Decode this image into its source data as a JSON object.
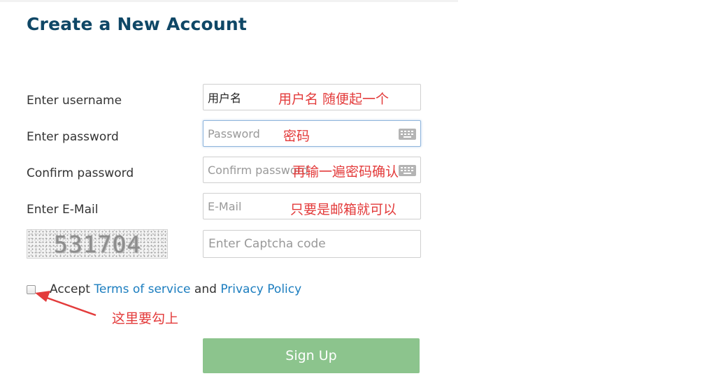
{
  "title": "Create a New Account",
  "labels": {
    "username": "Enter username",
    "password": "Enter password",
    "confirm": "Confirm password",
    "email": "Enter E-Mail"
  },
  "fields": {
    "username_value": "用户名",
    "password_placeholder": "Password",
    "confirm_placeholder": "Confirm password",
    "email_placeholder": "E-Mail",
    "captcha_placeholder": "Enter Captcha code"
  },
  "captcha_text": "531704",
  "annotations": {
    "username": "用户名  随便起一个",
    "password": "密码",
    "confirm": "再输一遍密码确认",
    "email": "只要是邮箱就可以",
    "checkbox": "这里要勾上"
  },
  "terms": {
    "accept": "Accept",
    "terms_link": "Terms of service",
    "and": "and",
    "privacy_link": "Privacy Policy"
  },
  "signup_label": "Sign Up",
  "icons": {
    "keyboard": "keyboard-icon",
    "arrow": "red-arrow-icon"
  },
  "colors": {
    "title": "#0f4766",
    "link": "#1b7dbf",
    "button": "#8cc48d",
    "annotation": "#e33b3b"
  }
}
